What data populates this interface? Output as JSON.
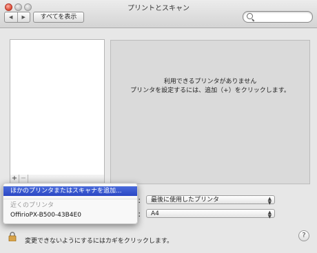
{
  "window": {
    "title": "プリントとスキャン"
  },
  "toolbar": {
    "back": "◀",
    "forward": "▶",
    "show_all": "すべてを表示",
    "search_placeholder": ""
  },
  "printer_list": {
    "add": "+",
    "remove": "−"
  },
  "detail": {
    "line1": "利用できるプリンタがありません",
    "line2": "プリンタを設定するには、追加（+）をクリックします。"
  },
  "settings": {
    "default_printer_label_suffix": "：",
    "default_printer_value": "最後に使用したプリンタ",
    "paper_size_label_suffix": "：",
    "paper_size_value": "A4"
  },
  "footer": {
    "lock_text": "変更できないようにするにはカギをクリックします。",
    "help": "?"
  },
  "add_menu": {
    "add_other": "ほかのプリンタまたはスキャナを追加...",
    "nearby_header": "近くのプリンタ",
    "nearby_printer": "OffirioPX-B500-43B4E0"
  },
  "colors": {
    "highlight": "#2b47c4",
    "close": "#d8452f"
  }
}
